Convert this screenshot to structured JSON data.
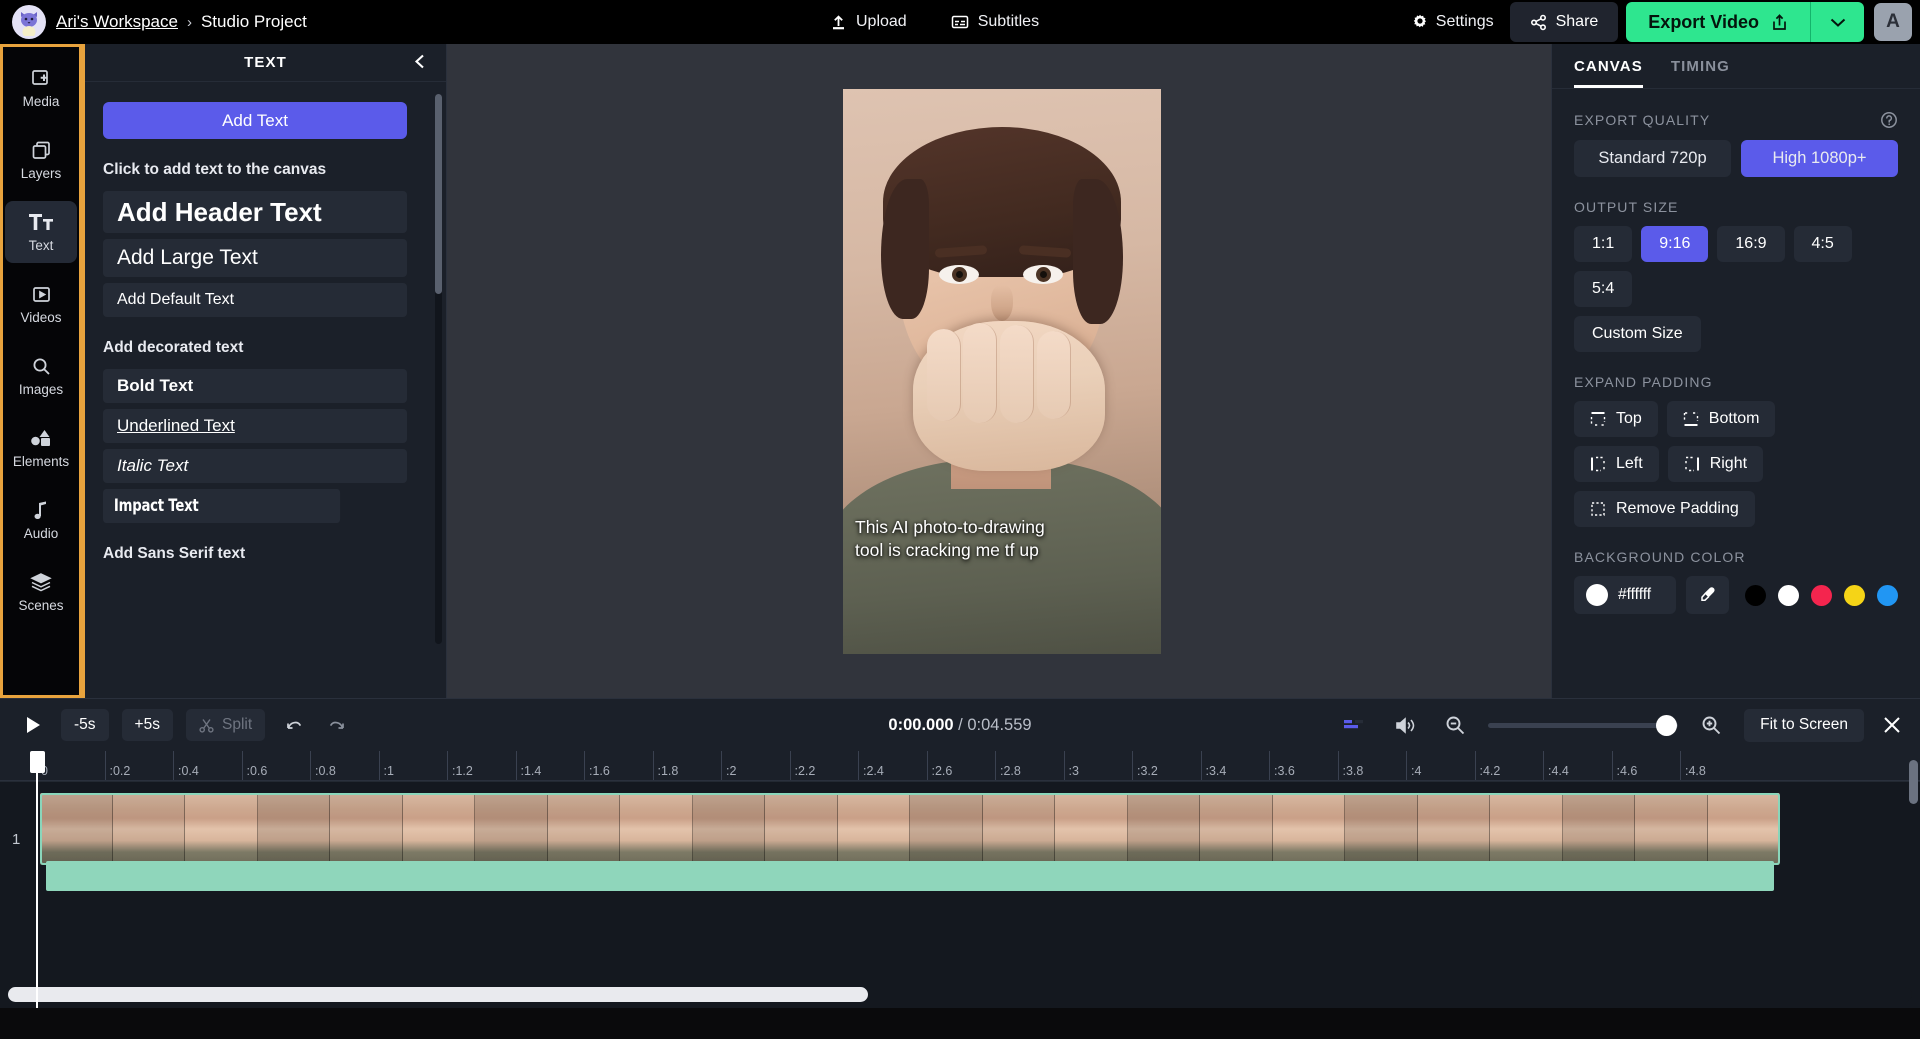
{
  "topbar": {
    "logo_icon": "cat-avatar-logo",
    "workspace": "Ari's Workspace",
    "separator": "›",
    "project": "Studio Project",
    "upload_label": "Upload",
    "upload_icon": "upload-icon",
    "subtitles_label": "Subtitles",
    "subtitles_icon": "subtitles-icon",
    "settings_label": "Settings",
    "settings_icon": "gear-icon",
    "share_label": "Share",
    "share_icon": "share-icon",
    "export_label": "Export Video",
    "export_icon": "export-share-icon",
    "export_caret_icon": "chevron-down-icon",
    "user_initial": "A",
    "accent_green": "#2ee68f",
    "accent_purple": "#5b5bea"
  },
  "rail": {
    "items": [
      {
        "label": "Media",
        "icon": "media-add-icon",
        "active": false
      },
      {
        "label": "Layers",
        "icon": "layers-icon",
        "active": false
      },
      {
        "label": "Text",
        "icon": "text-tt-icon",
        "active": true
      },
      {
        "label": "Videos",
        "icon": "video-play-icon",
        "active": false
      },
      {
        "label": "Images",
        "icon": "search-icon",
        "active": false
      },
      {
        "label": "Elements",
        "icon": "shapes-icon",
        "active": false
      },
      {
        "label": "Audio",
        "icon": "music-note-icon",
        "active": false
      },
      {
        "label": "Scenes",
        "icon": "stack-icon",
        "active": false
      }
    ],
    "highlight_color": "#e8a33d"
  },
  "panel": {
    "title": "TEXT",
    "collapse_icon": "chevron-left-icon",
    "add_text_button": "Add Text",
    "hint_label": "Click to add text to the canvas",
    "basic_styles": [
      {
        "label": "Add Header Text",
        "style": "header"
      },
      {
        "label": "Add Large Text",
        "style": "large"
      },
      {
        "label": "Add Default Text",
        "style": "default"
      }
    ],
    "decorated_label": "Add decorated text",
    "decorated_styles": [
      {
        "label": "Bold Text",
        "style": "bold"
      },
      {
        "label": "Underlined Text",
        "style": "under"
      },
      {
        "label": "Italic Text",
        "style": "italic"
      },
      {
        "label": "Impact Text",
        "style": "impact"
      }
    ],
    "sans_label": "Add Sans Serif text"
  },
  "stage": {
    "caption_line1": "This AI photo-to-drawing",
    "caption_line2": "tool is cracking me tf up",
    "handle_dots": "•••"
  },
  "rightpanel": {
    "tabs": [
      {
        "label": "CANVAS",
        "active": true
      },
      {
        "label": "TIMING",
        "active": false
      }
    ],
    "export_quality": {
      "title": "EXPORT QUALITY",
      "help_icon": "help-circle-icon",
      "options": [
        {
          "label": "Standard 720p",
          "selected": false
        },
        {
          "label": "High 1080p+",
          "selected": true
        }
      ]
    },
    "output_size": {
      "title": "OUTPUT SIZE",
      "ratios": [
        {
          "label": "1:1",
          "selected": false
        },
        {
          "label": "9:16",
          "selected": true
        },
        {
          "label": "16:9",
          "selected": false
        },
        {
          "label": "4:5",
          "selected": false
        },
        {
          "label": "5:4",
          "selected": false
        }
      ],
      "custom_label": "Custom Size"
    },
    "expand_padding": {
      "title": "EXPAND PADDING",
      "buttons": [
        {
          "label": "Top",
          "icon": "padding-top-icon"
        },
        {
          "label": "Bottom",
          "icon": "padding-bottom-icon"
        },
        {
          "label": "Left",
          "icon": "padding-left-icon"
        },
        {
          "label": "Right",
          "icon": "padding-right-icon"
        },
        {
          "label": "Remove Padding",
          "icon": "padding-none-icon"
        }
      ]
    },
    "background_color": {
      "title": "BACKGROUND COLOR",
      "hex": "#ffffff",
      "picker_icon": "eyedropper-icon",
      "swatches": [
        "#000000",
        "#ffffff",
        "#f4254e",
        "#f5d417",
        "#2196f3"
      ]
    }
  },
  "timeline": {
    "play_icon": "play-icon",
    "back_label": "-5s",
    "forward_label": "+5s",
    "split_label": "Split",
    "split_icon": "scissors-icon",
    "undo_icon": "undo-icon",
    "redo_icon": "redo-icon",
    "current_time": "0:00.000",
    "time_separator": "/",
    "total_time": "0:04.559",
    "align_icon": "align-icon",
    "volume_icon": "volume-icon",
    "zoom_out_icon": "zoom-out-icon",
    "zoom_in_icon": "zoom-in-icon",
    "fit_label": "Fit to Screen",
    "close_icon": "close-icon",
    "track_number": "1",
    "ruler_ticks": [
      "0",
      ":0.2",
      ":0.4",
      ":0.6",
      ":0.8",
      ":1",
      ":1.2",
      ":1.4",
      ":1.6",
      ":1.8",
      ":2",
      ":2.2",
      ":2.4",
      ":2.6",
      ":2.8",
      ":3",
      ":3.2",
      ":3.4",
      ":3.6",
      ":3.8",
      ":4",
      ":4.2",
      ":4.4",
      ":4.6",
      ":4.8"
    ]
  }
}
